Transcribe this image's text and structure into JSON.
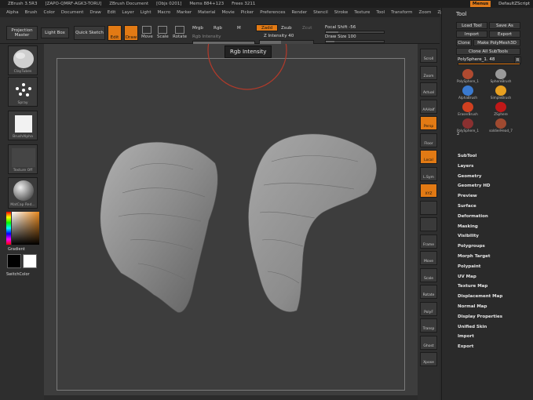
{
  "titlebar": {
    "app": "ZBrush 3.5R3",
    "serial": "[ZAPO-QMRF-AGK3-TORU]",
    "document": "ZBrush Document",
    "objs": "[Objs 0201]",
    "mem": "Mems 884+123",
    "free": "Frees 3211",
    "menus_label": "Menus",
    "script_label": "DefaultZScript"
  },
  "menubar": [
    "Alpha",
    "Brush",
    "Color",
    "Document",
    "Draw",
    "Edit",
    "Layer",
    "Light",
    "Macro",
    "Marker",
    "Material",
    "Movie",
    "Picker",
    "Preferences",
    "Render",
    "Stencil",
    "Stroke",
    "Texture",
    "Tool",
    "Transform",
    "Zoom",
    "Zplugin",
    "Zscript"
  ],
  "topshelf": {
    "projection_master": "Projection Master",
    "lightbox": "Light Box",
    "quick_sketch": "Quick Sketch",
    "edit": "Edit",
    "draw": "Draw",
    "move": "Move",
    "scale": "Scale",
    "rotate": "Rotate",
    "mrgb": "Mrgb",
    "rgb": "Rgb",
    "m": "M",
    "rgb_intensity": "Rgb Intensity",
    "zadd": "Zadd",
    "zsub": "Zsub",
    "zcut": "Zcut",
    "z_intensity": "Z Intensity 40",
    "focal_shift": "Focal Shift -56",
    "draw_size": "Draw Size 100"
  },
  "leftshelf": {
    "brush": "ClayTubes",
    "stroke": "Spray",
    "alpha": "BrushAlpha",
    "texture": "Texture Off",
    "material": "MatCap Red...",
    "gradient": "Gradient",
    "switchcolor": "SwitchColor"
  },
  "tooltip": "Rgb Intensity",
  "rightshelf": [
    "Scroll",
    "Zoom",
    "Actual",
    "AAHalf",
    "Persp",
    "Floor",
    "Local",
    "L.Sym",
    "XYZ",
    "",
    "",
    "Frame",
    "Move",
    "Scale",
    "Rotate",
    "PolyF",
    "Transp",
    "Ghost",
    "Xpose"
  ],
  "palette": {
    "title": "Tool",
    "load_tool": "Load Tool",
    "save_as": "Save As",
    "import": "Import",
    "export": "Export",
    "clone": "Clone",
    "make_polymesh": "Make PolyMesh3D",
    "clone_all": "Clone All SubTools",
    "current_tool": "PolySphere_1. 48",
    "r_button": "R",
    "tool_count": "2",
    "tools": [
      "PolySphere_1",
      "SphereBrush",
      "AlphaBrush",
      "SimpleBrush",
      "EraserBrush",
      "ZSphere",
      "PolySphere_1",
      "soldierHead_7"
    ],
    "sections": [
      "SubTool",
      "Layers",
      "Geometry",
      "Geometry HD",
      "Preview",
      "Surface",
      "Deformation",
      "Masking",
      "Visibility",
      "Polygroups",
      "Morph Target",
      "Polypaint",
      "UV Map",
      "Texture Map",
      "Displacement Map",
      "Normal Map",
      "Display Properties",
      "Unified Skin",
      "Import",
      "Export"
    ]
  },
  "colors": {
    "accent": "#e27a14",
    "panel": "#2e2e2e",
    "viewport": "#3d3d3d",
    "mesh": "#8e8e8e"
  }
}
